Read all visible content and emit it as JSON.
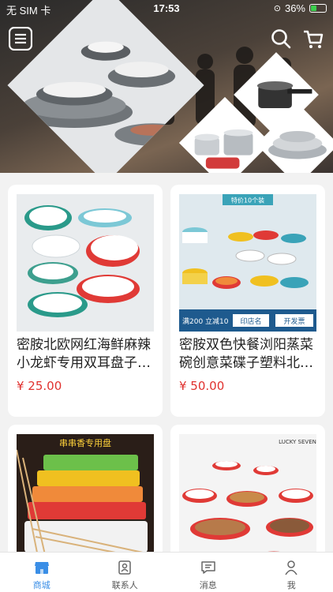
{
  "status_bar": {
    "carrier": "无 SIM 卡",
    "time": "17:53",
    "battery": "36%",
    "battery_level": 0.36
  },
  "products": [
    {
      "name": "密胺北欧网红海鲜麻辣小龙虾专用双耳盘子…",
      "price": "¥ 25.00"
    },
    {
      "name": "密胺双色快餐浏阳蒸菜碗创意菜碟子塑料北…",
      "price": "¥ 50.00",
      "promo_top": "特价10个装",
      "promo_left": "满200 立减10",
      "promo_mid": "印店名",
      "promo_right": "开发票"
    },
    {
      "name": "",
      "price": "",
      "promo_top": "串串香专用盘"
    },
    {
      "name": "",
      "price": "",
      "promo_top": "LUCKY SEVEN"
    }
  ],
  "tabs": [
    {
      "label": "商城",
      "icon": "store-icon",
      "active": true
    },
    {
      "label": "联系人",
      "icon": "contacts-icon",
      "active": false
    },
    {
      "label": "消息",
      "icon": "message-icon",
      "active": false
    },
    {
      "label": "我",
      "icon": "person-icon",
      "active": false
    }
  ],
  "colors": {
    "accent": "#3a8ee6",
    "price": "#e0312e",
    "battery": "#3ccf4e"
  }
}
